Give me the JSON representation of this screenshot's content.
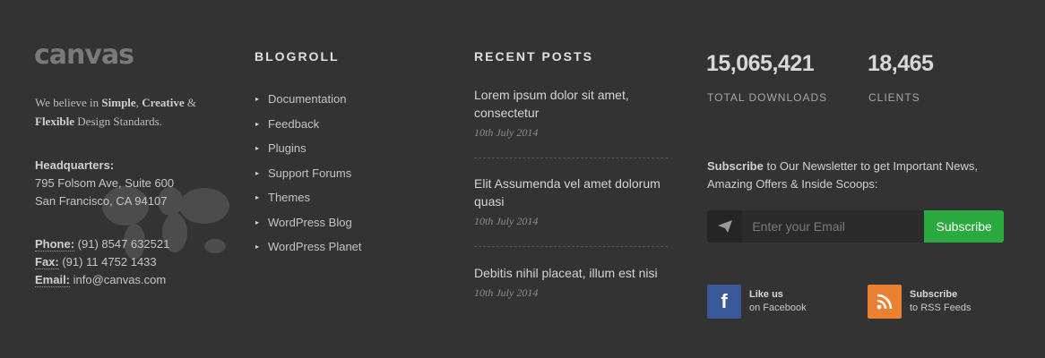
{
  "brand": {
    "logo_text": "canvas"
  },
  "about": {
    "p1": "We believe in ",
    "b1": "Simple",
    "p2": ", ",
    "b2": "Creative",
    "p3": " & ",
    "b3": "Flexible",
    "p4": " Design Standards."
  },
  "headquarters": {
    "label": "Headquarters:",
    "line1": "795 Folsom Ave, Suite 600",
    "line2": "San Francisco, CA 94107"
  },
  "contact": {
    "phone_label": "Phone:",
    "phone": " (91) 8547 632521",
    "fax_label": "Fax:",
    "fax": " (91) 11 4752 1433",
    "email_label": "Email:",
    "email": " info@canvas.com"
  },
  "blogroll": {
    "heading": "BLOGROLL",
    "items": [
      "Documentation",
      "Feedback",
      "Plugins",
      "Support Forums",
      "Themes",
      "WordPress Blog",
      "WordPress Planet"
    ]
  },
  "recent_posts": {
    "heading": "RECENT POSTS",
    "posts": [
      {
        "title": "Lorem ipsum dolor sit amet, consectetur",
        "date": "10th July 2014"
      },
      {
        "title": "Elit Assumenda vel amet dolorum quasi",
        "date": "10th July 2014"
      },
      {
        "title": "Debitis nihil placeat, illum est nisi",
        "date": "10th July 2014"
      }
    ]
  },
  "stats": {
    "downloads_value": "15,065,421",
    "downloads_label": "TOTAL DOWNLOADS",
    "clients_value": "18,465",
    "clients_label": "CLIENTS"
  },
  "newsletter": {
    "text_bold": "Subscribe",
    "text_rest": " to Our Newsletter to get Important News, Amazing Offers & Inside Scoops:",
    "placeholder": "Enter your Email",
    "button_label": "Subscribe"
  },
  "social": {
    "facebook": {
      "line1": "Like us",
      "line2": "on Facebook",
      "icon": "facebook-icon",
      "color": "#3b5998"
    },
    "rss": {
      "line1": "Subscribe",
      "line2": "to RSS Feeds",
      "icon": "rss-icon",
      "color": "#ea8130"
    }
  },
  "colors": {
    "background": "#333333",
    "accent": "#2aaa3e"
  }
}
